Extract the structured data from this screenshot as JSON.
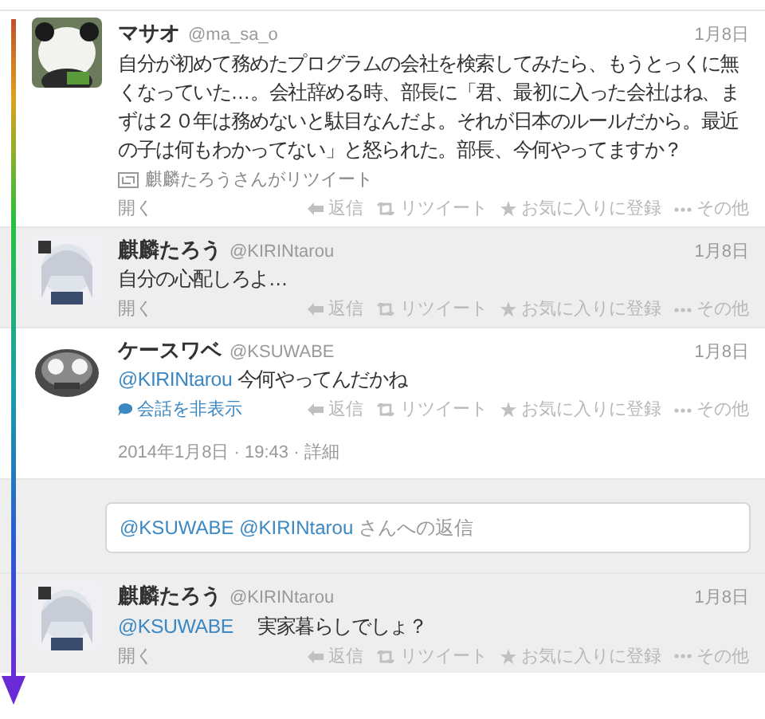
{
  "tweets": [
    {
      "name": "マサオ",
      "handle": "@ma_sa_o",
      "date": "1月8日",
      "shaded": false,
      "avatar": {
        "kind": "picture"
      },
      "body": [
        {
          "kind": "plain",
          "text": "自分が初めて務めたプログラムの会社を検索してみたら、もうとっくに無くなっていた…。会社辞める時、部長に「君、最初に入った会社はね、まずは２０年は務めないと駄目なんだよ。それが日本のルールだから。最近の子は何もわかってない」と怒られた。部長、今何やってますか？"
        }
      ],
      "retweeted_by": "麒麟たろうさんがリツイート",
      "expand": {
        "kind": "open",
        "text": "開く"
      },
      "actions": [
        "返信",
        "リツイート",
        "お気に入りに登録",
        "その他"
      ]
    },
    {
      "name": "麒麟たろう",
      "handle": "@KIRINtarou",
      "date": "1月8日",
      "shaded": true,
      "avatar": {
        "kind": "picture"
      },
      "body": [
        {
          "kind": "plain",
          "text": "自分の心配しろよ…"
        }
      ],
      "expand": {
        "kind": "open",
        "text": "開く"
      },
      "actions": [
        "返信",
        "リツイート",
        "お気に入りに登録",
        "その他"
      ]
    },
    {
      "name": "ケースワベ",
      "handle": "@KSUWABE",
      "date": "1月8日",
      "shaded": false,
      "avatar": {
        "kind": "picture"
      },
      "body": [
        {
          "kind": "mention",
          "text": "@KIRINtarou"
        },
        {
          "kind": "plain",
          "text": " 今何やってんだかね"
        }
      ],
      "expand": {
        "kind": "conversation",
        "text": "会話を非表示"
      },
      "actions": [
        "返信",
        "リツイート",
        "お気に入りに登録",
        "その他"
      ],
      "timestamp": "2014年1月8日 · 19:43 · 詳細"
    },
    {
      "kind": "reply_box",
      "parts": [
        {
          "kind": "mention",
          "text": "@KSUWABE"
        },
        {
          "kind": "mention",
          "text": " @KIRINtarou"
        },
        {
          "kind": "plain",
          "text": " さんへの返信"
        }
      ]
    },
    {
      "name": "麒麟たろう",
      "handle": "@KIRINtarou",
      "date": "1月8日",
      "shaded": true,
      "avatar": {
        "kind": "picture"
      },
      "body": [
        {
          "kind": "mention",
          "text": "@KSUWABE"
        },
        {
          "kind": "plain",
          "text": "　 実家暮らしでしょ？"
        }
      ],
      "expand": {
        "kind": "open",
        "text": "開く"
      },
      "actions": [
        "返信",
        "リツイート",
        "お気に入りに登録",
        "その他"
      ]
    }
  ]
}
